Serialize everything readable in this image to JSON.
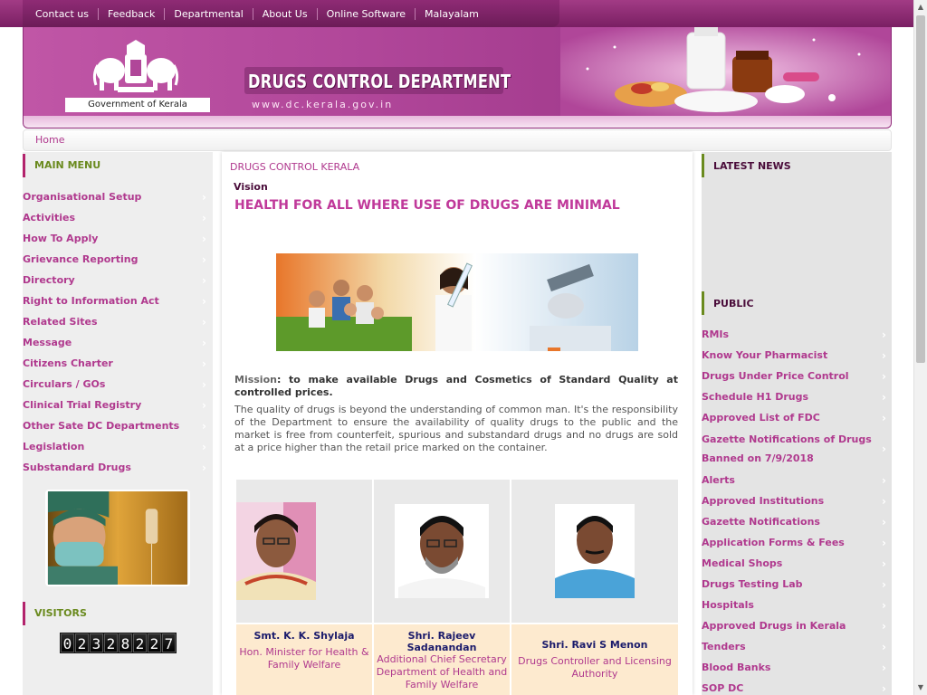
{
  "topnav": {
    "links": [
      "Contact us",
      "Feedback",
      "Departmental",
      "About Us",
      "Online Software",
      "Malayalam"
    ]
  },
  "header": {
    "gov_label": "Government of Kerala",
    "title": "DRUGS CONTROL DEPARTMENT",
    "url": "www.dc.kerala.gov.in"
  },
  "breadcrumb": {
    "home": "Home"
  },
  "left": {
    "main_menu_title": "MAIN MENU",
    "items": [
      "Organisational Setup",
      "Activities",
      "How To Apply",
      "Grievance Reporting",
      "Directory",
      "Right to Information Act",
      "Related Sites",
      "Message",
      "Citizens Charter",
      "Circulars / GOs",
      "Clinical Trial Registry",
      "Other Sate DC Departments",
      "Legislation",
      "Substandard Drugs"
    ],
    "visitors_title": "VISITORS",
    "visitor_count": "02328227"
  },
  "center": {
    "title": "DRUGS CONTROL KERALA",
    "vision_label": "Vision",
    "vision_text": "HEALTH FOR ALL WHERE USE OF DRUGS ARE MINIMAL",
    "mission_label": "Mission",
    "mission_text": ": to make available Drugs and Cosmetics of Standard Quality at controlled prices.",
    "quality_text": "The quality of drugs is beyond the understanding of common man. It's the responsibility of the Department to ensure the availability of quality drugs to the public and the market is free from counterfeit, spurious and substandard drugs and no drugs are sold at a price higher than the retail price marked on the container.",
    "people": [
      {
        "name": "Smt. K. K. Shylaja",
        "role": "Hon. Minister for Health & Family Welfare"
      },
      {
        "name": "Shri. Rajeev Sadanandan",
        "role": "Additional Chief Secretary Department of Health and Family Welfare"
      },
      {
        "name": "Shri. Ravi S Menon",
        "role": "Drugs Controller and Licensing Authority"
      }
    ]
  },
  "right": {
    "news_title": "LATEST NEWS",
    "public_title": "PUBLIC",
    "items": [
      "RMIs",
      "Know Your Pharmacist",
      "Drugs Under Price Control",
      "Schedule H1 Drugs",
      "Approved List of FDC",
      "Gazette Notifications of Drugs Banned on 7/9/2018",
      "Alerts",
      "Approved Institutions",
      "Gazette Notifications",
      "Application Forms & Fees",
      "Medical Shops",
      "Drugs Testing Lab",
      "Hospitals",
      "Approved Drugs in Kerala",
      "Tenders",
      "Blood Banks",
      "SOP DC"
    ]
  },
  "colors": {
    "brand": "#b0398e",
    "header": "#a13a8c",
    "accent_green": "#6a8a1e"
  }
}
